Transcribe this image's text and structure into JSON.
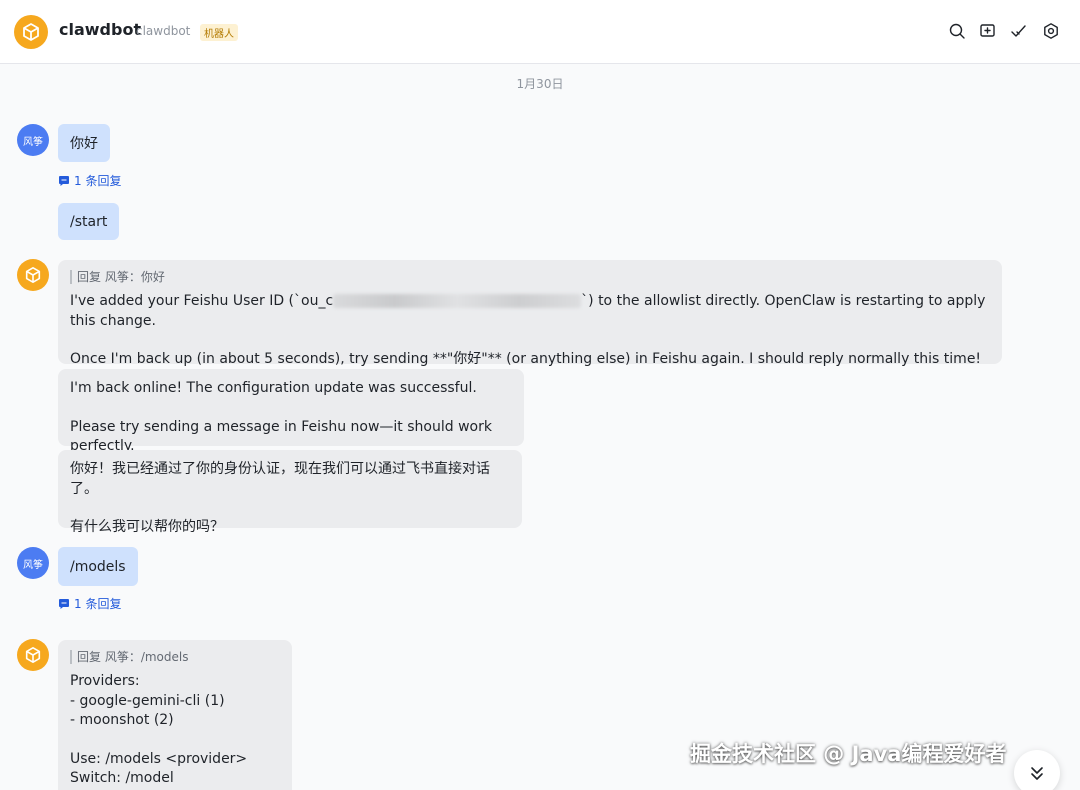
{
  "header": {
    "title": "clawdbot",
    "subtitle": "clawdbot",
    "badge": "机器人",
    "icons": [
      "search-icon",
      "add-chat-icon",
      "check-icon",
      "settings-icon"
    ]
  },
  "date_divider": "1月30日",
  "user": {
    "avatar_text": "风筝"
  },
  "messages": {
    "m1": {
      "text": "你好",
      "reply_count": "1 条回复"
    },
    "m2": {
      "text": "/start"
    },
    "m3": {
      "quote": "回复 风筝：你好",
      "line1_before": "I've added your Feishu User ID (`ou_c",
      "line1_after": "`) to the allowlist directly. OpenClaw is restarting to apply this change.",
      "line2": "Once I'm back up (in about 5 seconds), try sending **\"你好\"** (or anything else) in Feishu again. I should reply normally this time!"
    },
    "m4": {
      "line1": "I'm back online! The configuration update was successful.",
      "line2": "Please try sending a message in Feishu now—it should work perfectly."
    },
    "m5": {
      "line1": "你好！我已经通过了你的身份认证，现在我们可以通过飞书直接对话了。",
      "line2": "有什么我可以帮你的吗？"
    },
    "m6": {
      "text": "/models",
      "reply_count": "1 条回复"
    },
    "m7": {
      "quote": "回复 风筝：/models",
      "l1": "Providers:",
      "l2": "- google-gemini-cli (1)",
      "l3": "- moonshot (2)",
      "l4": "Use: /models <provider>",
      "l5": "Switch: /model <provider/model>"
    }
  },
  "watermark": "掘金技术社区 @ Java编程爱好者",
  "colors": {
    "accent": "#245bdb",
    "bot_avatar": "#f6a81e",
    "user_avatar": "#4c7cf2",
    "user_bubble": "#cfe1fd",
    "bot_bubble": "#ebecee"
  }
}
